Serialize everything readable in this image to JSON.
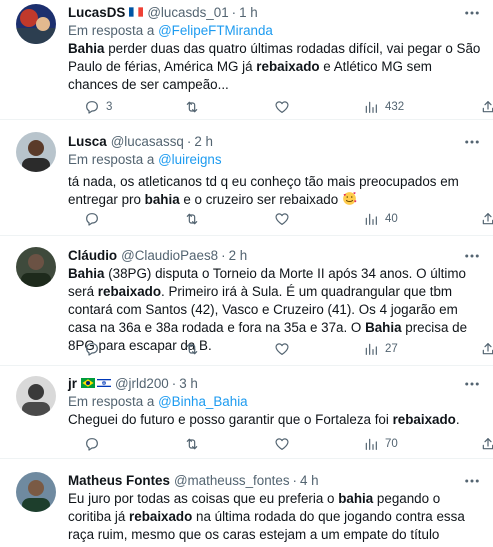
{
  "reply_prefix": "Em resposta a",
  "tweets": [
    {
      "name": "LucasDS",
      "handle": "@lucasds_01",
      "time": "1 h",
      "reply_to": "@FelipeFTMiranda",
      "text_segments": [
        {
          "t": "Bahia",
          "b": true
        },
        {
          "t": " perder duas das quatro últimas rodadas difícil, vai pegar o São Paulo de férias, América MG já ",
          "b": false
        },
        {
          "t": "rebaixado",
          "b": true
        },
        {
          "t": " e Atlético MG sem chances de ser campeão...",
          "b": false
        }
      ],
      "replies": "3",
      "retweets": "",
      "likes": "",
      "views": "432"
    },
    {
      "name": "Lusca",
      "handle": "@lucasassq",
      "time": "2 h",
      "reply_to": "@luireigns",
      "text_segments": [
        {
          "t": "tá nada, os atleticanos td q eu conheço tão mais preocupados em entregar pro ",
          "b": false
        },
        {
          "t": "bahia",
          "b": true
        },
        {
          "t": " e o cruzeiro ser rebaixado ",
          "b": false
        }
      ],
      "replies": "",
      "retweets": "",
      "likes": "",
      "views": "40"
    },
    {
      "name": "Cláudio",
      "handle": "@ClaudioPaes8",
      "time": "2 h",
      "reply_to": "",
      "text_segments": [
        {
          "t": "Bahia",
          "b": true
        },
        {
          "t": " (38PG) disputa o Torneio da Morte II após 34 anos. O último será ",
          "b": false
        },
        {
          "t": "rebaixado",
          "b": true
        },
        {
          "t": ". Primeiro irá à Sula. É um quadrangular que tbm contará com Santos (42), Vasco e Cruzeiro (41). Os 4 jogarão em casa na 36a e 38a rodada e fora na 35a e 37a. O ",
          "b": false
        },
        {
          "t": "Bahia",
          "b": true
        },
        {
          "t": " precisa de 8PG para escapar da B.",
          "b": false
        }
      ],
      "replies": "",
      "retweets": "",
      "likes": "",
      "views": "27"
    },
    {
      "name": "jr",
      "handle": "@jrld200",
      "time": "3 h",
      "reply_to": "@Binha_Bahia",
      "text_segments": [
        {
          "t": "Cheguei do futuro e posso garantir que o Fortaleza foi ",
          "b": false
        },
        {
          "t": "rebaixado",
          "b": true
        },
        {
          "t": ".",
          "b": false
        }
      ],
      "replies": "",
      "retweets": "",
      "likes": "",
      "views": "70"
    },
    {
      "name": "Matheus Fontes",
      "handle": "@matheuss_fontes",
      "time": "4 h",
      "reply_to": "",
      "text_segments": [
        {
          "t": "Eu juro por todas as coisas que eu preferia o ",
          "b": false
        },
        {
          "t": "bahia",
          "b": true
        },
        {
          "t": " pegando o coritiba já ",
          "b": false
        },
        {
          "t": "rebaixado",
          "b": true
        },
        {
          "t": " na última rodada do que jogando contra essa raça ruim, mesmo que os caras estejam a um empate do título",
          "b": false
        }
      ],
      "replies": "",
      "retweets": "",
      "likes": "",
      "views": ""
    }
  ],
  "colors": {
    "text": "#0f1419",
    "secondary": "#536471",
    "link": "#1d9bf0",
    "divider": "#eff3f4"
  },
  "icons": [
    "more-icon",
    "reply-icon",
    "retweet-icon",
    "like-icon",
    "views-icon",
    "share-icon",
    "france-flag-icon",
    "brazil-flag-icon",
    "israel-flag-icon",
    "smiling-hearts-emoji"
  ]
}
